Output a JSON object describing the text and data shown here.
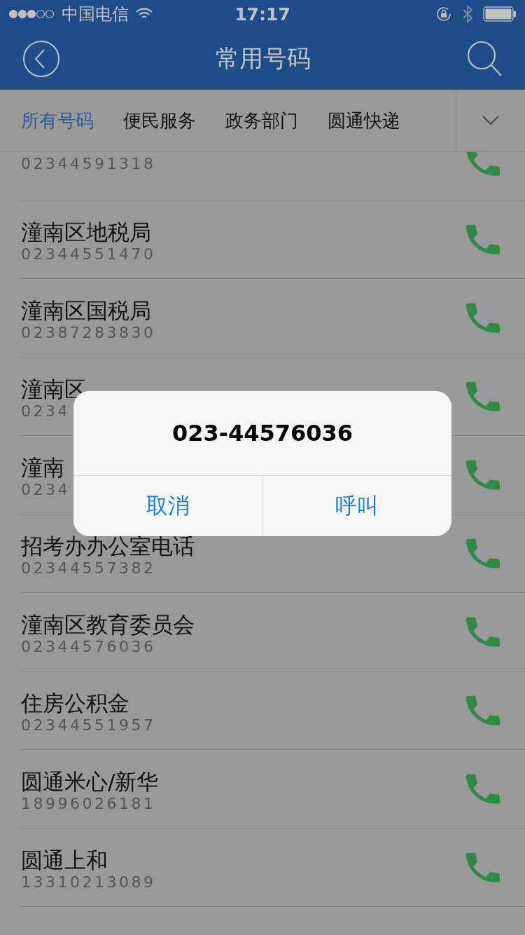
{
  "status_bar": {
    "carrier": "中国电信",
    "time": "17:17"
  },
  "nav": {
    "title": "常用号码"
  },
  "tabs": [
    {
      "label": "所有号码",
      "selected": true
    },
    {
      "label": "便民服务",
      "selected": false
    },
    {
      "label": "政务部门",
      "selected": false
    },
    {
      "label": "圆通快递",
      "selected": false
    }
  ],
  "contacts": [
    {
      "phone": "02344591318"
    },
    {
      "name": "潼南区地税局",
      "phone": "02344551470"
    },
    {
      "name": "潼南区国税局",
      "phone": "02387283830"
    },
    {
      "name": "潼南区",
      "phone": "0234"
    },
    {
      "name": "潼南",
      "phone": "0234"
    },
    {
      "name": "招考办办公室电话",
      "phone": "02344557382"
    },
    {
      "name": "潼南区教育委员会",
      "phone": "02344576036"
    },
    {
      "name": "住房公积金",
      "phone": "02344551957"
    },
    {
      "name": "圆通米心/新华",
      "phone": "18996026181"
    },
    {
      "name": "圆通上和",
      "phone": "13310213089"
    }
  ],
  "dialog": {
    "message": "023-44576036",
    "buttons": [
      {
        "label": "取消"
      },
      {
        "label": "呼叫"
      }
    ]
  }
}
